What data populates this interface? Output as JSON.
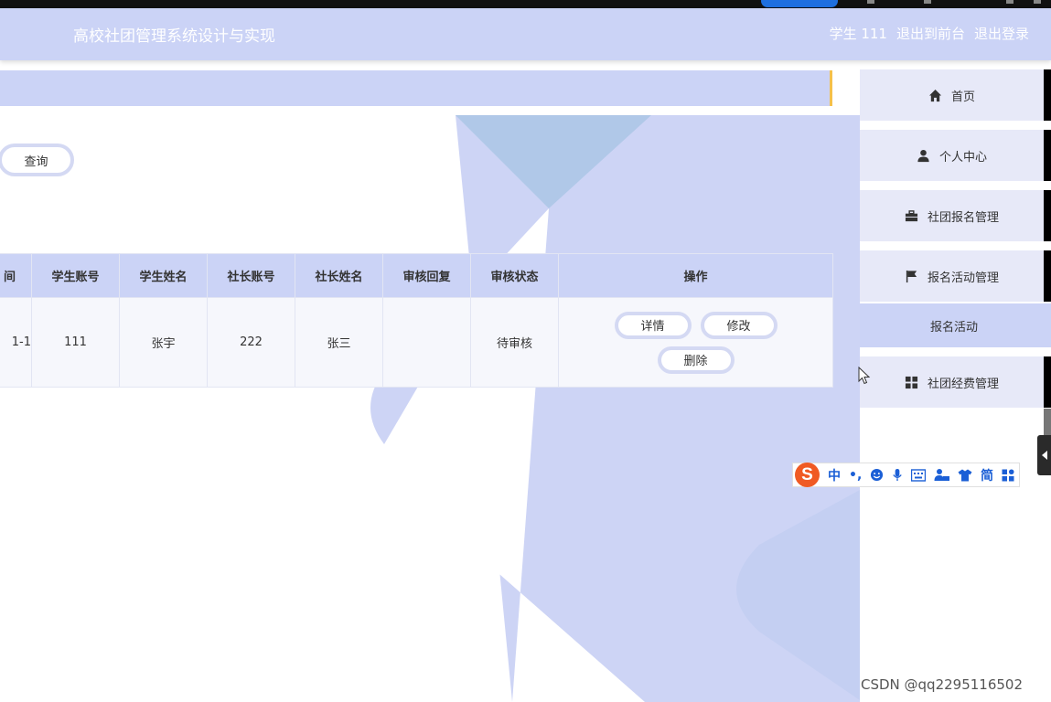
{
  "header": {
    "title": "高校社团管理系统设计与实现",
    "user": "学生 111",
    "exit_front": "退出到前台",
    "logout": "退出登录"
  },
  "search": {
    "query_label": "查询"
  },
  "table": {
    "columns": [
      "间",
      "学生账号",
      "学生姓名",
      "社长账号",
      "社长姓名",
      "审核回复",
      "审核状态",
      "操作"
    ],
    "rows": [
      {
        "time": "1-1",
        "student_account": "111",
        "student_name": "张宇",
        "leader_account": "222",
        "leader_name": "张三",
        "review_reply": "",
        "review_status": "待审核",
        "actions": {
          "detail": "详情",
          "edit": "修改",
          "delete": "删除"
        }
      }
    ]
  },
  "sidebar": {
    "items": [
      {
        "label": "首页",
        "icon": "home-icon"
      },
      {
        "label": "个人中心",
        "icon": "user-icon"
      },
      {
        "label": "社团报名管理",
        "icon": "briefcase-icon"
      },
      {
        "label": "报名活动管理",
        "icon": "flag-icon"
      },
      {
        "label": "社团经费管理",
        "icon": "grid-icon"
      }
    ],
    "sub_item": "报名活动"
  },
  "ime_toolbar": {
    "logo": "S",
    "mode": "中",
    "punct": "•,",
    "simplified": "简"
  },
  "watermark": "CSDN @qq2295116502",
  "colors": {
    "header": "#cbd3f6",
    "accent_bar": "#f5c04a",
    "nav_bg": "#e7e9f8",
    "ime_blue": "#1b5fd6"
  }
}
